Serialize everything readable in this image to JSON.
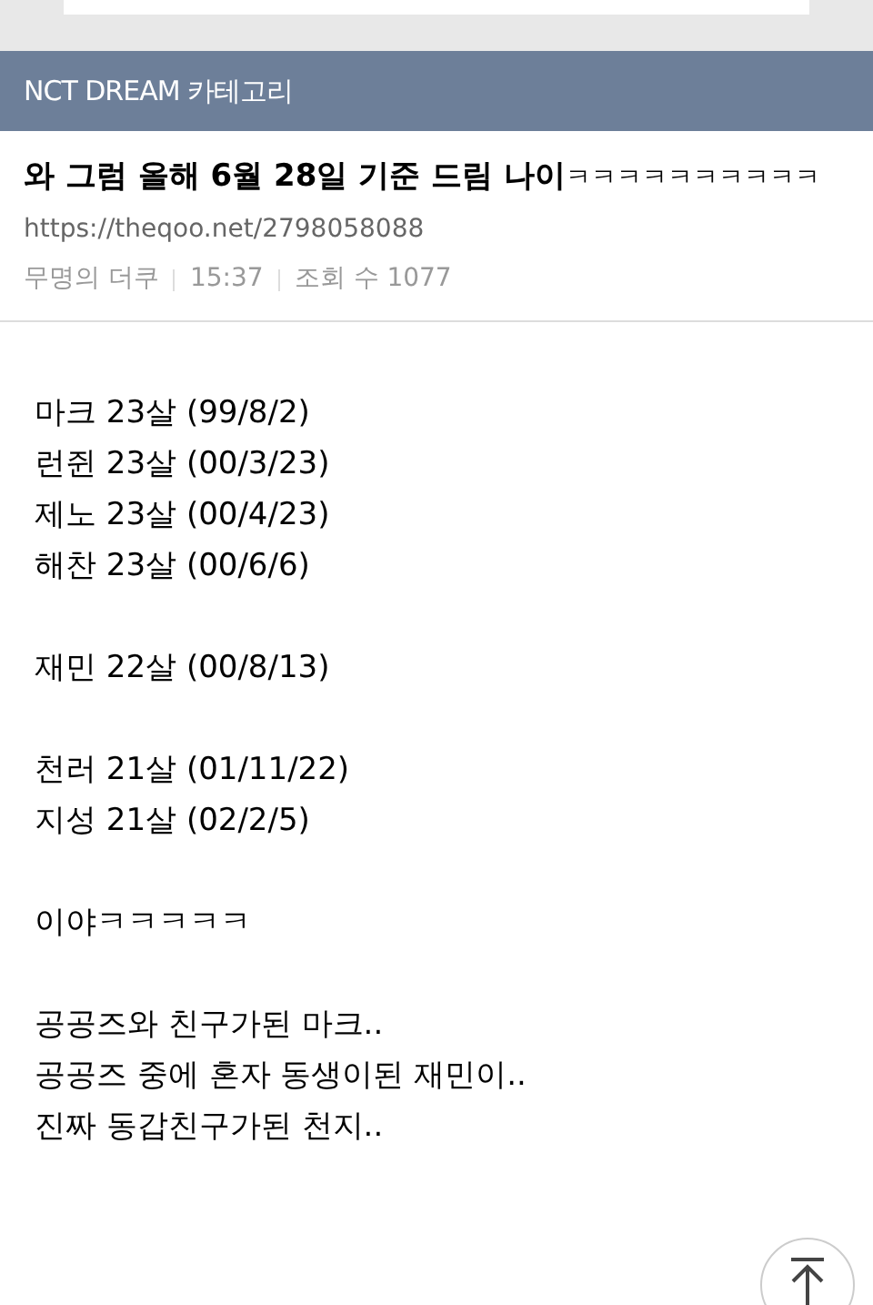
{
  "category_bar": {
    "title": "NCT DREAM 카테고리"
  },
  "post": {
    "title": "와 그럼 올해 6월 28일 기준 드림 나이",
    "title_suffix": "ㅋㅋㅋㅋㅋㅋㅋㅋㅋㅋ",
    "url": "https://theqoo.net/2798058088",
    "author": "무명의 더쿠",
    "time": "15:37",
    "views": "조회 수 1077"
  },
  "body": [
    [
      "마크 23살 (99/8/2)",
      "런쥔 23살 (00/3/23)",
      "제노 23살 (00/4/23)",
      "해찬 23살 (00/6/6)"
    ],
    [
      "재민 22살 (00/8/13)"
    ],
    [
      "천러 21살 (01/11/22)",
      "지성 21살 (02/2/5)"
    ],
    [
      "이야ㅋㅋㅋㅋㅋ"
    ],
    [
      "공공즈와 친구가된 마크..",
      "공공즈 중에 혼자 동생이된 재민이..",
      "진짜 동갑친구가된 천지.."
    ]
  ]
}
